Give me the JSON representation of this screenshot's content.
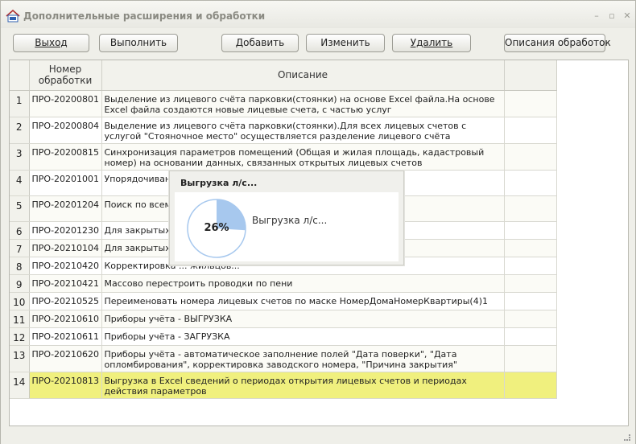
{
  "window": {
    "title": "Дополнительные расширения и обработки"
  },
  "toolbar": {
    "exit_label": "Выход",
    "run_label": "Выполнить",
    "add_label": "Добавить",
    "edit_label": "Изменить",
    "delete_label": "Удалить",
    "descriptions_label": "Описания обработок"
  },
  "table": {
    "columns": [
      "",
      "Номер обработки",
      "Описание",
      ""
    ],
    "rows": [
      {
        "n": "1",
        "code": "ПРО-20200801",
        "desc": "Выделение из лицевого счёта парковки(стоянки) на основе Excel файла.На основе Excel файла создаются новые лицевые счета, с частью услуг"
      },
      {
        "n": "2",
        "code": "ПРО-20200804",
        "desc": "Выделение из лицевого счёта парковки(стоянки).Для всех лицевых счетов с услугой \"Стояночное место\" осуществляется разделение лицевого счёта"
      },
      {
        "n": "3",
        "code": "ПРО-20200815",
        "desc": "Синхронизация параметров помещений (Общая и жилая площадь, кадастровый номер) на основании данных, связанных открытых лицевых счетов"
      },
      {
        "n": "4",
        "code": "ПРО-20201001",
        "desc": "Упорядочивание ... 3) Капитальные ремонты 4) Дом..."
      },
      {
        "n": "5",
        "code": "ПРО-20201204",
        "desc": "Поиск по всем б... мер прибора учета\" + \"Услуга\""
      },
      {
        "n": "6",
        "code": "ПРО-20201230",
        "desc": "Для закрытых п... ртир\""
      },
      {
        "n": "7",
        "code": "ПРО-20210104",
        "desc": "Для закрытых л... раметров"
      },
      {
        "n": "8",
        "code": "ПРО-20210420",
        "desc": "Корректировка ... жильцов...\""
      },
      {
        "n": "9",
        "code": "ПРО-20210421",
        "desc": "Массово перестроить проводки по пени"
      },
      {
        "n": "10",
        "code": "ПРО-20210525",
        "desc": "Переименовать номера лицевых счетов по маске НомерДомаНомерКвартиры(4)1"
      },
      {
        "n": "11",
        "code": "ПРО-20210610",
        "desc": "Приборы учёта - ВЫГРУЗКА"
      },
      {
        "n": "12",
        "code": "ПРО-20210611",
        "desc": "Приборы учёта - ЗАГРУЗКА"
      },
      {
        "n": "13",
        "code": "ПРО-20210620",
        "desc": "Приборы учёта - автоматическое заполнение полей \"Дата поверки\", \"Дата опломбирования\", корректировка заводского номера, \"Причина закрытия\""
      },
      {
        "n": "14",
        "code": "ПРО-20210813",
        "desc": "Выгрузка в Excel сведений о периодах открытия лицевых счетов и периодах действия параметров"
      }
    ]
  },
  "progress_dialog": {
    "title": "Выгрузка л/с...",
    "message": "Выгрузка л/с...",
    "percent_label": "26%",
    "percent_value": 26,
    "fill_color": "#a7c8ee",
    "track_color": "#ffffff"
  },
  "colors": {
    "selected_row": "#f0f07e"
  }
}
